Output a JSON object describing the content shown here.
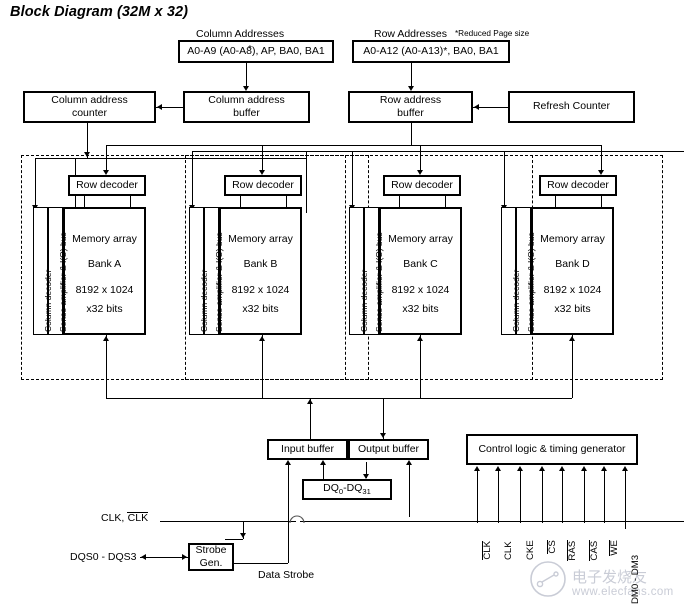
{
  "title": "Block Diagram (32M x 32)",
  "top_inputs": {
    "column": {
      "caption": "Column Addresses",
      "value": "A0-A9 (A0-A8), AP, BA0, BA1"
    },
    "row": {
      "caption": "Row Addresses",
      "footnote": "*Reduced Page size",
      "value": "A0-A12 (A0-A13)*, BA0, BA1"
    }
  },
  "address_blocks": {
    "column_counter": "Column address counter",
    "column_counter_l1": "Column address",
    "column_counter_l2": "counter",
    "column_buffer_l1": "Column address",
    "column_buffer_l2": "buffer",
    "row_buffer_l1": "Row address",
    "row_buffer_l2": "buffer",
    "refresh_counter": "Refresh Counter"
  },
  "bank_common": {
    "row_decoder": "Row decoder",
    "column_decoder": "Column decoder",
    "sense_amp": "Sense amplifier & I(O) bus",
    "memory_array": "Memory array",
    "size_line1": "8192 x 1024",
    "size_line2": "x32 bits"
  },
  "banks": [
    {
      "name": "Bank A"
    },
    {
      "name": "Bank B"
    },
    {
      "name": "Bank C"
    },
    {
      "name": "Bank D"
    }
  ],
  "io": {
    "input_buffer": "Input buffer",
    "output_buffer": "Output buffer",
    "dq_prefix": "DQ",
    "dq_sub0": "0",
    "dq_dash": "-DQ",
    "dq_sub31": "31"
  },
  "control": {
    "logic_box": "Control logic & timing generator",
    "signals": [
      {
        "label": "CLK",
        "overbar": true
      },
      {
        "label": "CLK",
        "overbar": false
      },
      {
        "label": "CKE",
        "overbar": false
      },
      {
        "label": "CS",
        "overbar": true
      },
      {
        "label": "RAS",
        "overbar": true
      },
      {
        "label": "CAS",
        "overbar": true
      },
      {
        "label": "WE",
        "overbar": true
      },
      {
        "label": "DM0 - DM3",
        "overbar": false
      }
    ]
  },
  "strobe": {
    "clk_label_plain": "CLK, ",
    "clk_label_bar": "CLK",
    "dqs_label": "DQS0 - DQS3",
    "gen_l1": "Strobe",
    "gen_l2": "Gen.",
    "data_strobe": "Data Strobe"
  },
  "watermark": {
    "text": "电子发烧友",
    "url": "www.elecfans.com"
  }
}
